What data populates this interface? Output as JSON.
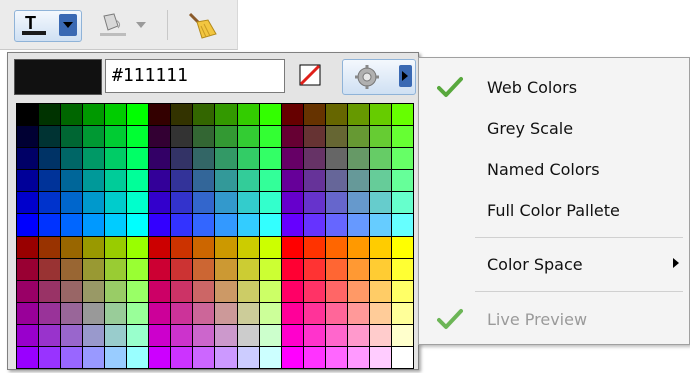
{
  "toolbar": {
    "text_color_icon": "text-color-icon",
    "fill_color_icon": "fill-bucket-icon",
    "broom_icon": "broom-icon"
  },
  "picker": {
    "current_color": "#111111",
    "hex_value": "#111111",
    "no_color_icon": "no-color-icon",
    "settings_icon": "gear-icon"
  },
  "menu": {
    "items": [
      {
        "label": "Web Colors",
        "checked": true
      },
      {
        "label": "Grey Scale",
        "checked": false
      },
      {
        "label": "Named Colors",
        "checked": false
      },
      {
        "label": "Full Color Pallete",
        "checked": false
      }
    ],
    "color_space_label": "Color Space",
    "live_preview_label": "Live Preview",
    "live_preview_checked": true
  }
}
